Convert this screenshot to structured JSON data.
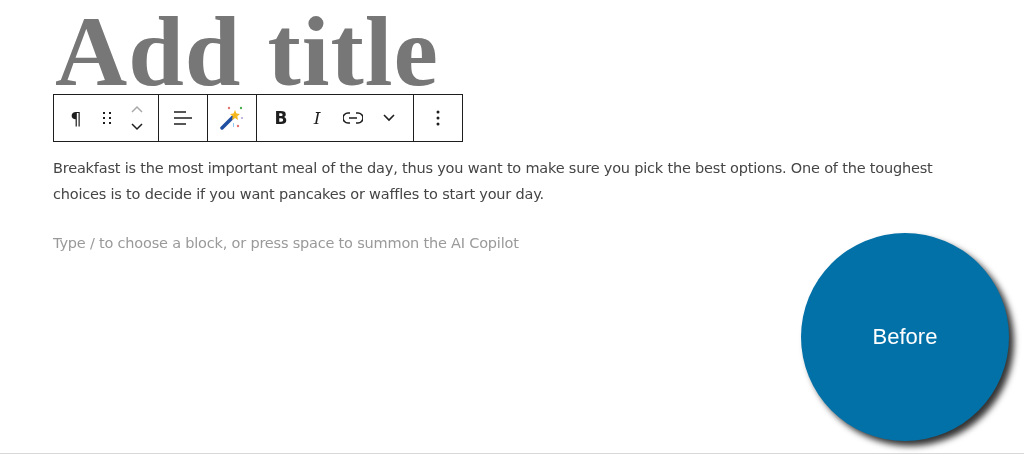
{
  "title": {
    "placeholder": "Add title"
  },
  "toolbar": {
    "groups": [
      {
        "items": [
          {
            "kind": "glyph",
            "text": "¶"
          },
          {
            "kind": "drag"
          },
          {
            "kind": "mover"
          }
        ]
      },
      {
        "items": [
          {
            "kind": "align"
          }
        ]
      },
      {
        "items": [
          {
            "kind": "magic"
          }
        ]
      },
      {
        "items": [
          {
            "kind": "bold",
            "text": "B"
          },
          {
            "kind": "italic",
            "text": "I"
          },
          {
            "kind": "link"
          },
          {
            "kind": "caret"
          }
        ]
      },
      {
        "items": [
          {
            "kind": "more"
          }
        ]
      }
    ]
  },
  "paragraph": "Breakfast is the most important meal of the day, thus you want to make sure you pick the best options. One of the toughest choices is to decide if you want pancakes or waffles to start your day.",
  "new_block": {
    "placeholder": "Type / to choose a block, or press space to summon the AI Copilot"
  },
  "badge": {
    "label": "Before"
  }
}
